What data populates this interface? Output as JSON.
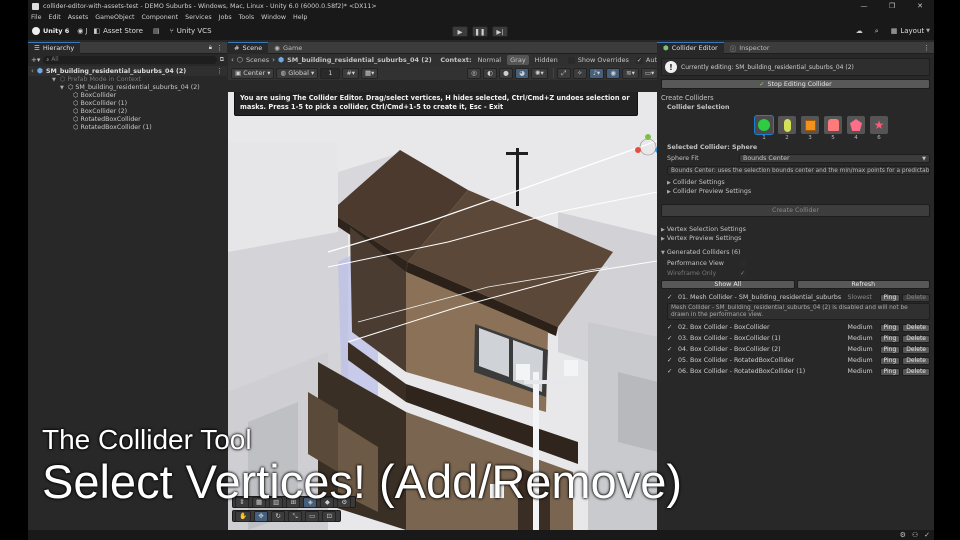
{
  "window": {
    "title": "collider-editor-with-assets-test - DEMO Suburbs - Windows, Mac, Linux - Unity 6.0 (6000.0.58f2)* <DX11>",
    "menu": [
      "File",
      "Edit",
      "Assets",
      "GameObject",
      "Component",
      "Services",
      "Jobs",
      "Tools",
      "Window",
      "Help"
    ]
  },
  "toolbar": {
    "account": "Unity 6",
    "user": "J",
    "asset_store": "Asset Store",
    "vcs": "Unity VCS",
    "layout": "Layout"
  },
  "hierarchy": {
    "tab": "Hierarchy",
    "search_placeholder": "All",
    "scene_root": "SM_building_residential_suburbs_04 (2)",
    "prefab_mode": "Prefab Mode in Context",
    "items": [
      {
        "label": "SM_building_residential_suburbs_04 (2)"
      },
      {
        "label": "BoxCollider"
      },
      {
        "label": "BoxCollider (1)"
      },
      {
        "label": "BoxCollider (2)"
      },
      {
        "label": "RotatedBoxCollider"
      },
      {
        "label": "RotatedBoxCollider (1)"
      }
    ]
  },
  "scene": {
    "tab_scene": "Scene",
    "tab_game": "Game",
    "breadcrumb_root": "Scenes",
    "breadcrumb_item": "SM_building_residential_suburbs_04 (2)",
    "context_label": "Context:",
    "context_normal": "Normal",
    "context_gray": "Gray",
    "context_hidden": "Hidden",
    "show_overrides": "Show Overrides",
    "auto_save": "Auto Save",
    "pivot": "Center",
    "space": "Global",
    "grid_value": "1",
    "info": "You are using The Collider Editor. Drag/select vertices, H hides selected, Ctrl/Cmd+Z undoes selection or masks. Press 1-5 to pick a collider, Ctrl/Cmd+1-5 to create it, Esc - Exit"
  },
  "overlay": {
    "line1": "The Collider Tool",
    "line2": "Select Vertices! (Add/Remove)"
  },
  "collider_editor": {
    "tab": "Collider Editor",
    "inspector_tab": "Inspector",
    "currently_editing": "Currently editing: SM_building_residential_suburbs_04 (2)",
    "stop_button": "Stop Editing Collider",
    "create_colliders": "Create Colliders",
    "collider_selection": "Collider Selection",
    "shapes": [
      {
        "num": "1",
        "color": "#2ecc40",
        "icon": "sphere-icon"
      },
      {
        "num": "2",
        "color": "#d4e157",
        "icon": "capsule-icon"
      },
      {
        "num": "3",
        "color": "#f5921e",
        "icon": "box-icon"
      },
      {
        "num": "5",
        "color": "#ff7a7a",
        "icon": "convex-hull-icon"
      },
      {
        "num": "4",
        "color": "#ff6f8a",
        "icon": "mesh-icon"
      },
      {
        "num": "6",
        "color": "#ff5a78",
        "icon": "star-icon"
      }
    ],
    "selected_collider": "Selected Collider: Sphere",
    "sphere_fit_label": "Sphere Fit",
    "sphere_fit_value": "Bounds Center",
    "sphere_fit_help": "Bounds Center: uses the selection bounds center and the min/max points for a predictable radius.",
    "collider_settings": "Collider Settings",
    "collider_preview_settings": "Collider Preview Settings",
    "create_button": "Create Collider",
    "vertex_selection_settings": "Vertex Selection Settings",
    "vertex_preview_settings": "Vertex Preview Settings",
    "generated_header": "Generated Colliders (6)",
    "performance_view": "Performance View",
    "wireframe_only": "Wireframe Only",
    "show_all": "Show All",
    "refresh": "Refresh",
    "mesh_row": {
      "label": "01. Mesh Collider - SM_building_residential_suburbs",
      "quality": "Slowest",
      "ping": "Ping",
      "delete": "Delete"
    },
    "mesh_warning": "Mesh Collider - SM_building_residential_suburbs_04 (2) is disabled and will not be drawn in the performance view.",
    "rows": [
      {
        "label": "02. Box Collider - BoxCollider",
        "quality": "Medium",
        "ping": "Ping",
        "delete": "Delete"
      },
      {
        "label": "03. Box Collider - BoxCollider (1)",
        "quality": "Medium",
        "ping": "Ping",
        "delete": "Delete"
      },
      {
        "label": "04. Box Collider - BoxCollider (2)",
        "quality": "Medium",
        "ping": "Ping",
        "delete": "Delete"
      },
      {
        "label": "05. Box Collider - RotatedBoxCollider",
        "quality": "Medium",
        "ping": "Ping",
        "delete": "Delete"
      },
      {
        "label": "06. Box Collider - RotatedBoxCollider (1)",
        "quality": "Medium",
        "ping": "Ping",
        "delete": "Delete"
      }
    ]
  }
}
